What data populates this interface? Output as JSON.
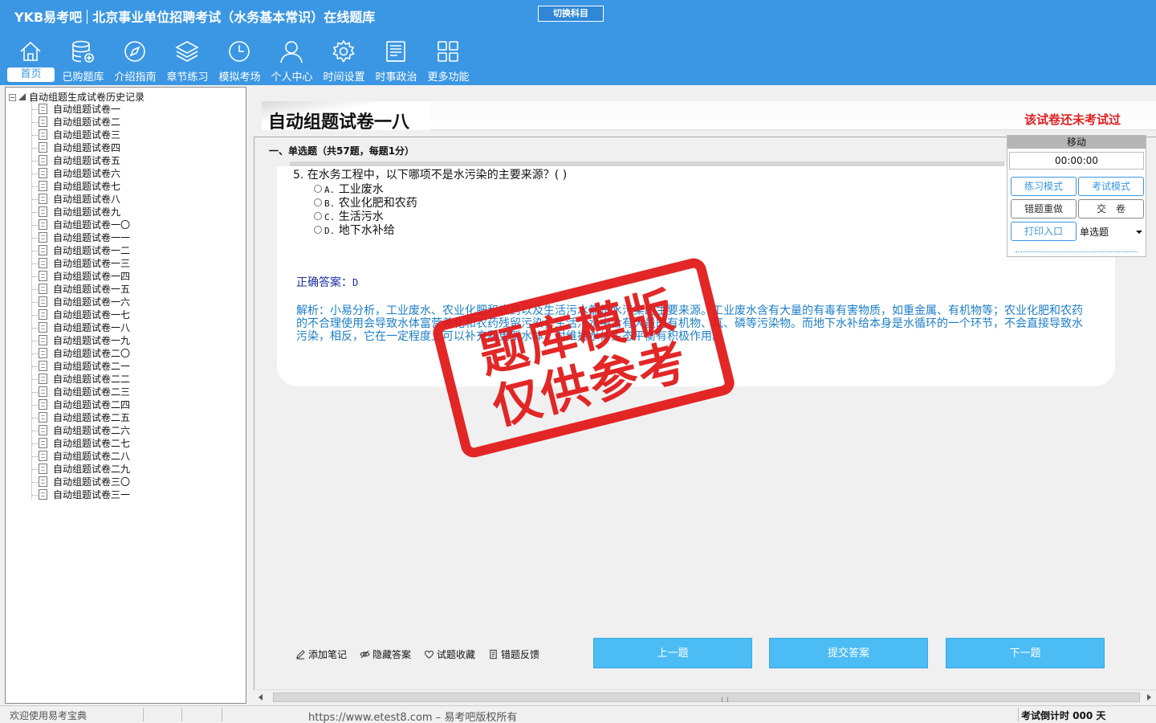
{
  "header": {
    "brand_logo": "YKB易考吧",
    "app_title": "北京事业单位招聘考试（水务基本常识）在线题库",
    "switch_subject": "切换科目",
    "nav": [
      {
        "label": "首页",
        "icon": "home-icon"
      },
      {
        "label": "已购题库",
        "icon": "database-add-icon"
      },
      {
        "label": "介绍指南",
        "icon": "compass-icon"
      },
      {
        "label": "章节练习",
        "icon": "layers-icon"
      },
      {
        "label": "模拟考场",
        "icon": "clock-icon"
      },
      {
        "label": "个人中心",
        "icon": "user-icon"
      },
      {
        "label": "时间设置",
        "icon": "gear-icon"
      },
      {
        "label": "时事政治",
        "icon": "news-icon"
      },
      {
        "label": "更多功能",
        "icon": "grid-icon"
      }
    ],
    "accent_color": "#3b97e3"
  },
  "tree": {
    "root_label": "自动组题生成试卷历史记录",
    "items": [
      "自动组题试卷一",
      "自动组题试卷二",
      "自动组题试卷三",
      "自动组题试卷四",
      "自动组题试卷五",
      "自动组题试卷六",
      "自动组题试卷七",
      "自动组题试卷八",
      "自动组题试卷九",
      "自动组题试卷一〇",
      "自动组题试卷一一",
      "自动组题试卷一二",
      "自动组题试卷一三",
      "自动组题试卷一四",
      "自动组题试卷一五",
      "自动组题试卷一六",
      "自动组题试卷一七",
      "自动组题试卷一八",
      "自动组题试卷一九",
      "自动组题试卷二〇",
      "自动组题试卷二一",
      "自动组题试卷二二",
      "自动组题试卷二三",
      "自动组题试卷二四",
      "自动组题试卷二五",
      "自动组题试卷二六",
      "自动组题试卷二七",
      "自动组题试卷二八",
      "自动组题试卷二九",
      "自动组题试卷三〇",
      "自动组题试卷三一"
    ]
  },
  "paper": {
    "title": "自动组题试卷一八",
    "status": "该试卷还未考试过",
    "section": "一、单选题（共57题，每题1分）"
  },
  "question": {
    "stem": "5. 在水务工程中，以下哪项不是水污染的主要来源？( )",
    "options": [
      {
        "key": "A.",
        "text": "工业废水"
      },
      {
        "key": "B.",
        "text": "农业化肥和农药"
      },
      {
        "key": "C.",
        "text": "生活污水"
      },
      {
        "key": "D.",
        "text": "地下水补给"
      }
    ],
    "answer_label": "正确答案：",
    "answer_value": "D",
    "analysis": "解析：小易分析，工业废水、农业化肥和农药以及生活污水都是水污染的主要来源。工业废水含有大量的有毒有害物质，如重金属、有机物等；农业化肥和农药的不合理使用会导致水体富营养化和农药残留污染；生活污水中含有大量的有机物、氮、磷等污染物。而地下水补给本身是水循环的一个环节，不会直接导致水污染，相反，它在一定程度上可以补充和更新水体，对维持水体生态平衡有积极作用。"
  },
  "panel": {
    "move": "移动",
    "timer": "00:00:00",
    "practice_mode": "练习模式",
    "exam_mode": "考试模式",
    "redo_wrong": "错题重做",
    "submit_paper": "交　卷",
    "print": "打印入口",
    "type_select": "单选题"
  },
  "tools": {
    "add_note": "添加笔记",
    "hide_answer": "隐藏答案",
    "favorite": "试题收藏",
    "feedback": "错题反馈"
  },
  "buttons": {
    "prev": "上一题",
    "submit": "提交答案",
    "next": "下一题"
  },
  "status": {
    "welcome": "欢迎使用易考宝典",
    "copyright": "https://www.etest8.com – 易考吧版权所有",
    "countdown": "考试倒计时 000 天"
  },
  "stamp": {
    "line1": "题库模版",
    "line2": "仅供参考"
  }
}
